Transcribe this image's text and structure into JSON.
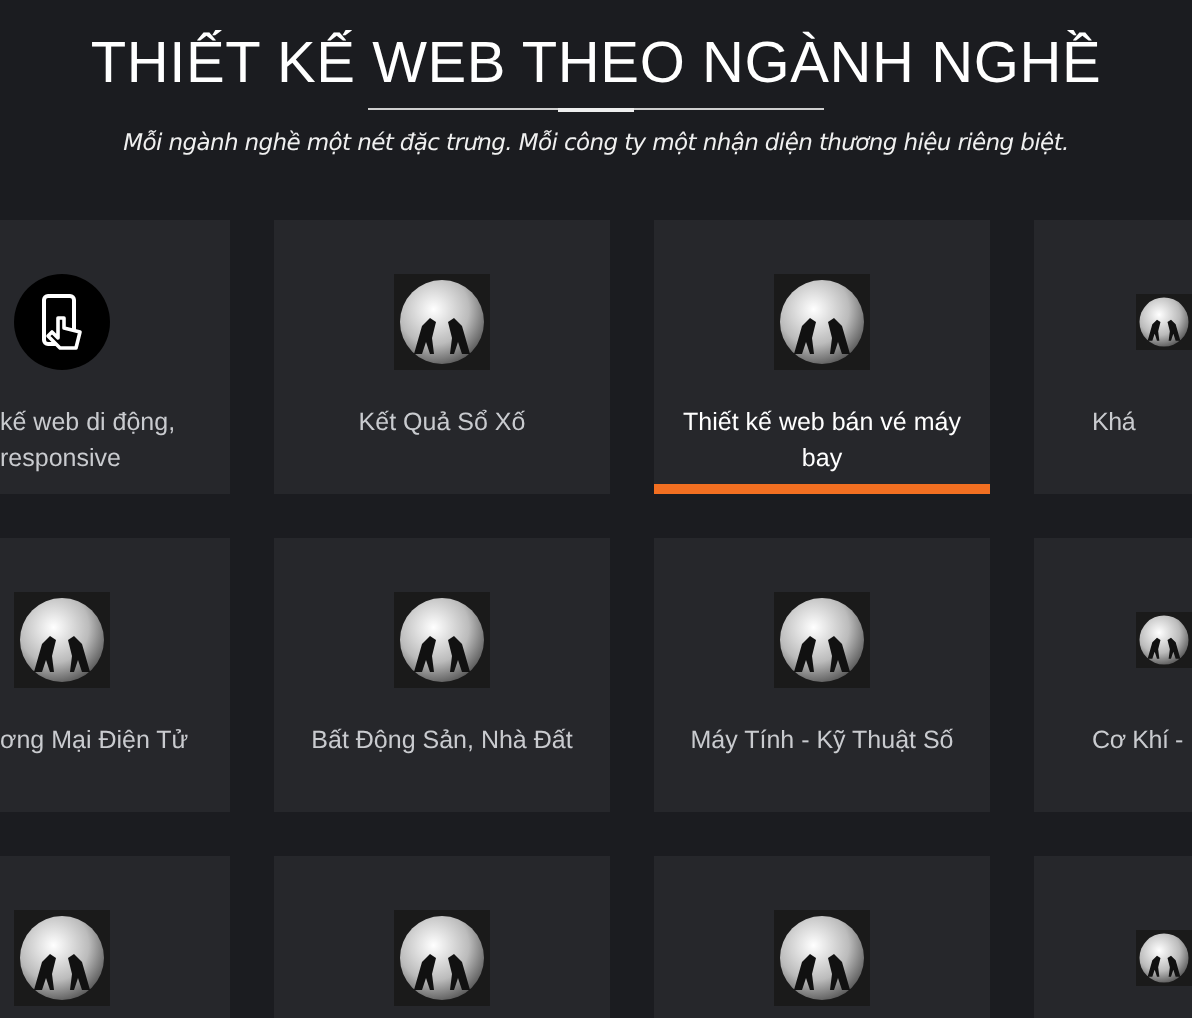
{
  "header": {
    "title": "THIẾT KẾ WEB THEO NGÀNH NGHỀ",
    "subtitle": "Mỗi ngành nghề một nét đặc trưng. Mỗi công ty một nhận diện thương hiệu riêng biệt."
  },
  "rows": [
    {
      "cards": [
        {
          "kind": "mobile",
          "label": "kế web di động, responsive",
          "selected": false
        },
        {
          "kind": "sphere",
          "label": "Kết Quả Sổ Xố",
          "selected": false
        },
        {
          "kind": "sphere",
          "label": "Thiết kế web bán vé máy bay",
          "selected": true
        },
        {
          "kind": "sphere",
          "label": "Khá",
          "selected": false
        }
      ]
    },
    {
      "cards": [
        {
          "kind": "sphere",
          "label": "ơng Mại Điện Tử",
          "selected": false
        },
        {
          "kind": "sphere",
          "label": "Bất Động Sản, Nhà Đất",
          "selected": false
        },
        {
          "kind": "sphere",
          "label": "Máy Tính - Kỹ Thuật Số",
          "selected": false
        },
        {
          "kind": "sphere",
          "label": "Cơ Khí -",
          "selected": false
        }
      ]
    },
    {
      "cards": [
        {
          "kind": "sphere"
        },
        {
          "kind": "sphere"
        },
        {
          "kind": "sphere"
        },
        {
          "kind": "sphere"
        }
      ]
    }
  ]
}
